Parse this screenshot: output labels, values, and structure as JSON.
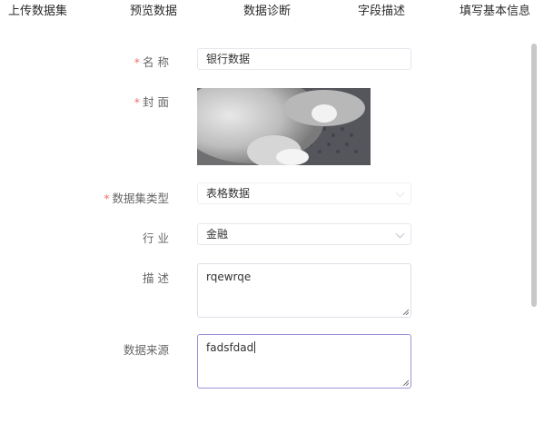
{
  "steps": [
    "上传数据集",
    "预览数据",
    "数据诊断",
    "字段描述",
    "填写基本信息"
  ],
  "form": {
    "name": {
      "label": "名 称",
      "required": true,
      "value": "银行数据"
    },
    "cover": {
      "label": "封 面",
      "required": true
    },
    "dataset_type": {
      "label": "数据集类型",
      "required": true,
      "value": "表格数据"
    },
    "industry": {
      "label": "行 业",
      "required": false,
      "value": "金融"
    },
    "description": {
      "label": "描 述",
      "required": false,
      "value": "rqewrqe"
    },
    "source": {
      "label": "数据来源",
      "required": false,
      "value": "fadsfdad"
    }
  },
  "required_mark": "*",
  "colors": {
    "required": "#f56c6c",
    "active_border": "#9a93d8",
    "border": "#dcdfe6"
  },
  "icons": [
    "chevron-down-icon",
    "resize-handle-icon"
  ]
}
